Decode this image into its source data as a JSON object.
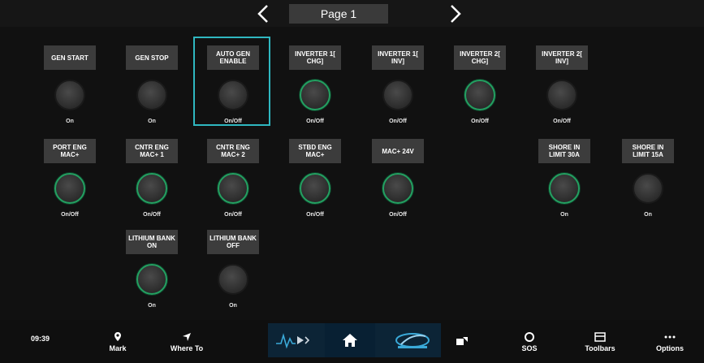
{
  "header": {
    "title": "Page 1"
  },
  "colors": {
    "accent_green": "#23a061",
    "selection": "#2fb7c0"
  },
  "buttons": [
    {
      "label": "GEN START",
      "state": "On",
      "on": false
    },
    {
      "label": "GEN STOP",
      "state": "On",
      "on": false
    },
    {
      "label": "AUTO GEN ENABLE",
      "state": "On/Off",
      "on": false,
      "selected": true
    },
    {
      "label": "INVERTER 1[ CHG]",
      "state": "On/Off",
      "on": true
    },
    {
      "label": "INVERTER 1[ INV]",
      "state": "On/Off",
      "on": false
    },
    {
      "label": "INVERTER 2[ CHG]",
      "state": "On/Off",
      "on": true
    },
    {
      "label": "INVERTER 2[ INV]",
      "state": "On/Off",
      "on": false
    },
    {
      "label": "PORT ENG MAC+",
      "state": "On/Off",
      "on": true
    },
    {
      "label": "CNTR ENG MAC+ 1",
      "state": "On/Off",
      "on": true
    },
    {
      "label": "CNTR ENG MAC+ 2",
      "state": "On/Off",
      "on": true
    },
    {
      "label": "STBD ENG MAC+",
      "state": "On/Off",
      "on": true
    },
    {
      "label": "MAC+ 24V",
      "state": "On/Off",
      "on": true
    },
    {
      "label": "SHORE IN LIMIT 30A",
      "state": "On",
      "on": true
    },
    {
      "label": "SHORE IN LIMIT 15A",
      "state": "On",
      "on": false
    },
    {
      "label": "LITHIUM BANK ON",
      "state": "On",
      "on": true
    },
    {
      "label": "LITHIUM BANK OFF",
      "state": "On",
      "on": false
    }
  ],
  "bottom_bar": {
    "time": "09:39‍",
    "items": [
      {
        "label": "Mark",
        "icon": "map-pin-icon"
      },
      {
        "label": "Where To",
        "icon": "navigation-arrow-icon"
      },
      {
        "label": "",
        "icon": "autopilot-icon"
      },
      {
        "label": "",
        "icon": "home-icon"
      },
      {
        "label": "",
        "icon": "brand-logo-icon"
      },
      {
        "label": "",
        "icon": "cast-icon"
      },
      {
        "label": "SOS",
        "icon": "lifebuoy-icon"
      },
      {
        "label": "Toolbars",
        "icon": "toolbar-icon"
      },
      {
        "label": "Options",
        "icon": "more-icon"
      }
    ]
  }
}
